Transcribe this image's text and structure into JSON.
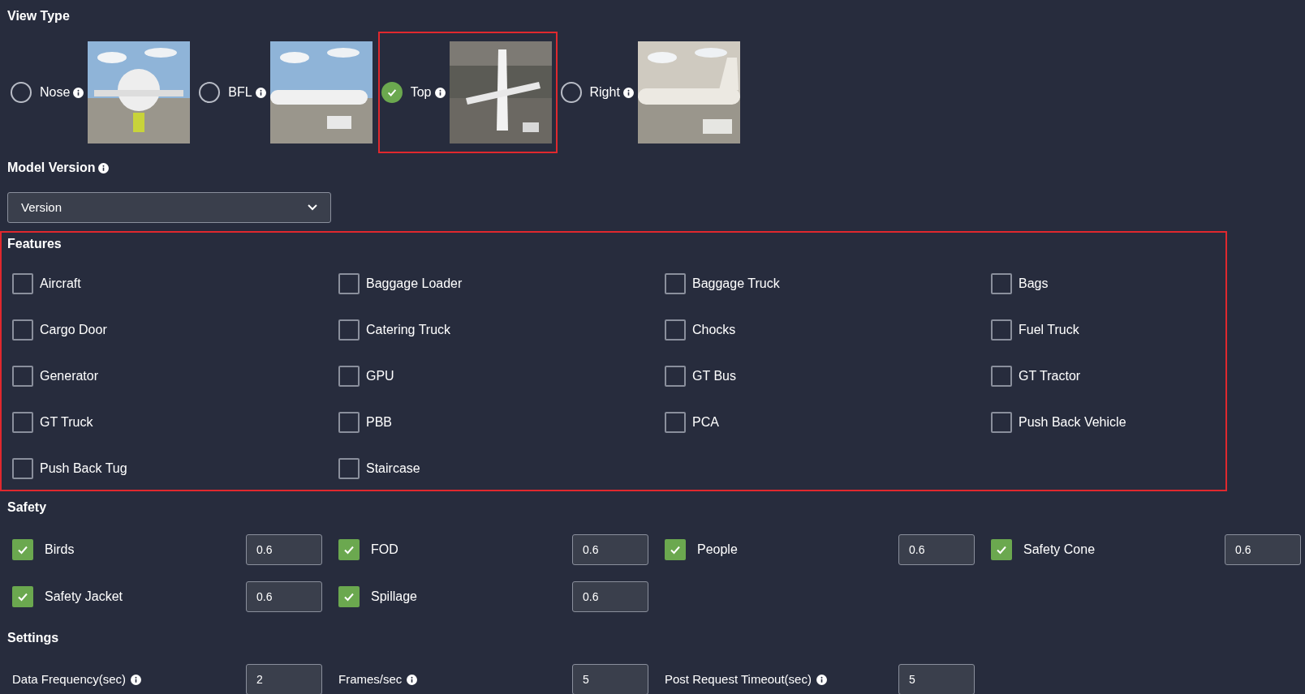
{
  "view_type": {
    "title": "View Type",
    "options": [
      {
        "label": "Nose",
        "selected": false,
        "highlighted": false
      },
      {
        "label": "BFL",
        "selected": false,
        "highlighted": false
      },
      {
        "label": "Top",
        "selected": true,
        "highlighted": true
      },
      {
        "label": "Right",
        "selected": false,
        "highlighted": false
      }
    ]
  },
  "model_version": {
    "title": "Model Version",
    "select": {
      "value": "Version"
    }
  },
  "features": {
    "title": "Features",
    "highlighted": true,
    "items": [
      {
        "label": "Aircraft",
        "checked": false
      },
      {
        "label": "Baggage Loader",
        "checked": false
      },
      {
        "label": "Baggage Truck",
        "checked": false
      },
      {
        "label": "Bags",
        "checked": false
      },
      {
        "label": "Cargo Door",
        "checked": false
      },
      {
        "label": "Catering Truck",
        "checked": false
      },
      {
        "label": "Chocks",
        "checked": false
      },
      {
        "label": "Fuel Truck",
        "checked": false
      },
      {
        "label": "Generator",
        "checked": false
      },
      {
        "label": "GPU",
        "checked": false
      },
      {
        "label": "GT Bus",
        "checked": false
      },
      {
        "label": "GT Tractor",
        "checked": false
      },
      {
        "label": "GT Truck",
        "checked": false
      },
      {
        "label": "PBB",
        "checked": false
      },
      {
        "label": "PCA",
        "checked": false
      },
      {
        "label": "Push Back Vehicle",
        "checked": false
      },
      {
        "label": "Push Back Tug",
        "checked": false
      },
      {
        "label": "Staircase",
        "checked": false
      }
    ]
  },
  "safety": {
    "title": "Safety",
    "items": [
      {
        "label": "Birds",
        "checked": true,
        "value": "0.6"
      },
      {
        "label": "FOD",
        "checked": true,
        "value": "0.6"
      },
      {
        "label": "People",
        "checked": true,
        "value": "0.6"
      },
      {
        "label": "Safety Cone",
        "checked": true,
        "value": "0.6"
      },
      {
        "label": "Safety Jacket",
        "checked": true,
        "value": "0.6"
      },
      {
        "label": "Spillage",
        "checked": true,
        "value": "0.6"
      }
    ]
  },
  "settings": {
    "title": "Settings",
    "items": [
      {
        "label": "Data Frequency(sec)",
        "value": "2"
      },
      {
        "label": "Frames/sec",
        "value": "5"
      },
      {
        "label": "Post Request Timeout(sec)",
        "value": "5"
      }
    ]
  }
}
